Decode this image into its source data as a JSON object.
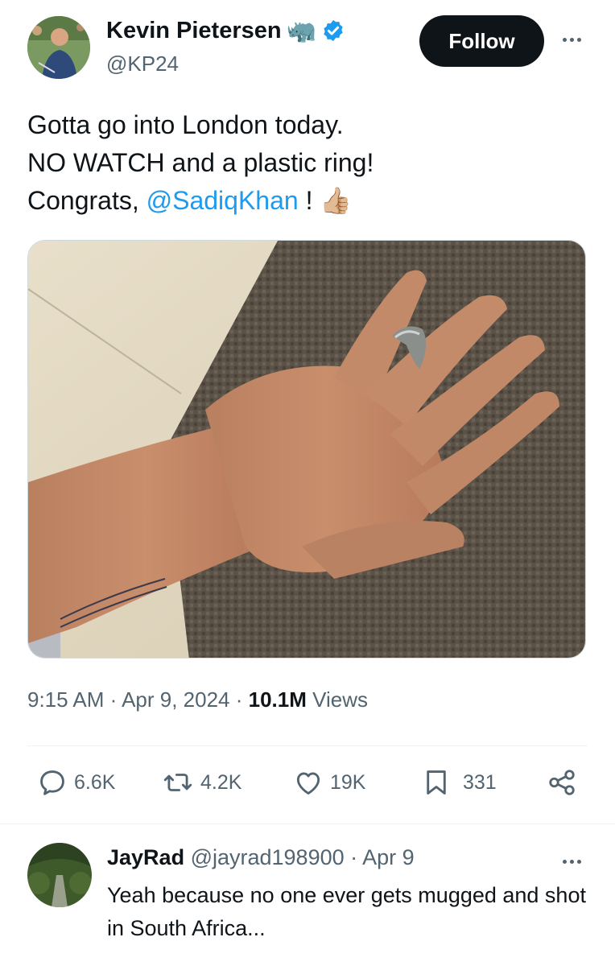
{
  "tweet": {
    "author": {
      "display_name": "Kevin Pietersen",
      "name_emoji": "🦏",
      "verified_icon": "verified-badge-icon",
      "handle": "@KP24"
    },
    "follow_label": "Follow",
    "text_lines": [
      "Gotta go into London today.",
      "NO WATCH and a plastic ring!"
    ],
    "text_line3_prefix": "Congrats, ",
    "mention": "@SadiqKhan",
    "text_line3_suffix": " !",
    "thumbs_emoji": "👍🏼",
    "time": "9:15 AM",
    "date": "Apr 9, 2024",
    "views_count": "10.1M",
    "views_label": "Views",
    "stats": {
      "replies": "6.6K",
      "retweets": "4.2K",
      "likes": "19K",
      "bookmarks": "331"
    }
  },
  "reply": {
    "display_name": "JayRad",
    "handle": "@jayrad198900",
    "date": "Apr 9",
    "text": "Yeah because no one ever gets mugged and shot in South Africa..."
  },
  "colors": {
    "accent": "#1d9bf0",
    "text_primary": "#0f1419",
    "text_secondary": "#536471",
    "follow_bg": "#0f1419"
  }
}
